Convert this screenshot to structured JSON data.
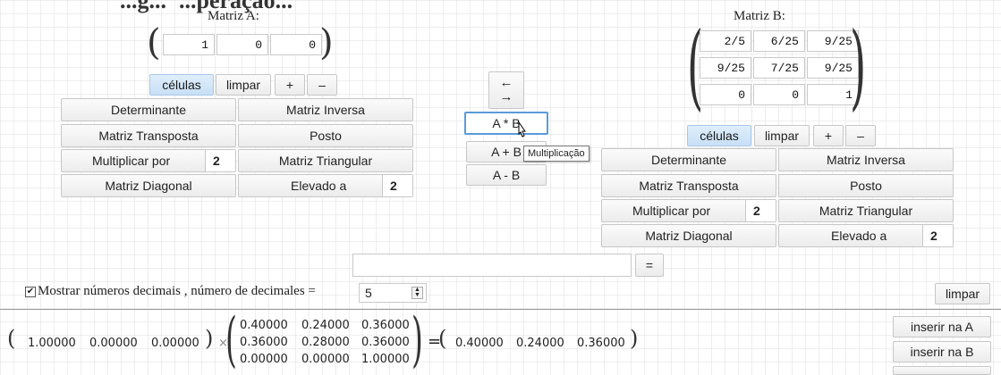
{
  "heading": {
    "text_a": "...g...",
    "text_b": "...peração..."
  },
  "matrixA": {
    "label": "Matriz A:",
    "cells": [
      "1",
      "0",
      "0"
    ],
    "toolbar": {
      "cells_label": "células",
      "clear_label": "limpar",
      "add_label": "+",
      "remove_label": "–"
    },
    "ops": {
      "determinant": "Determinante",
      "inverse": "Matriz Inversa",
      "transpose": "Matriz Transposta",
      "rank": "Posto",
      "multiply_by": "Multiplicar por",
      "multiply_value": "2",
      "triangular": "Matriz Triangular",
      "diagonal": "Matriz Diagonal",
      "power": "Elevado a",
      "power_value": "2"
    }
  },
  "matrixB": {
    "label": "Matriz B:",
    "cells": [
      [
        "2/5",
        "6/25",
        "9/25"
      ],
      [
        "9/25",
        "7/25",
        "9/25"
      ],
      [
        "0",
        "0",
        "1"
      ]
    ],
    "toolbar": {
      "cells_label": "células",
      "clear_label": "limpar",
      "add_label": "+",
      "remove_label": "–"
    },
    "ops": {
      "determinant": "Determinante",
      "inverse": "Matriz Inversa",
      "transpose": "Matriz Transposta",
      "rank": "Posto",
      "multiply_by": "Multiplicar por",
      "multiply_value": "2",
      "triangular": "Matriz Triangular",
      "diagonal": "Matriz Diagonal",
      "power": "Elevado a",
      "power_value": "2"
    }
  },
  "center": {
    "arrow_left": "←",
    "arrow_right": "→",
    "a_times_b": "A * B",
    "a_plus_b": "A + B",
    "a_minus_b": "A - B",
    "tooltip": "Multiplicação"
  },
  "expression": {
    "value": "",
    "equals_label": "="
  },
  "options": {
    "checked": true,
    "show_decimals_label": "Mostrar números decimais , número de decimales =",
    "decimals_value": "5",
    "clear_label": "limpar"
  },
  "result": {
    "left_row": [
      "1.00000",
      "0.00000",
      "0.00000"
    ],
    "matrix": [
      [
        "0.40000",
        "0.24000",
        "0.36000"
      ],
      [
        "0.36000",
        "0.28000",
        "0.36000"
      ],
      [
        "0.00000",
        "0.00000",
        "1.00000"
      ]
    ],
    "result_row": [
      "0.40000",
      "0.24000",
      "0.36000"
    ],
    "times_symbol": "×",
    "equals_symbol": "=",
    "insert_a_label": "inserir na A",
    "insert_b_label": "inserir na B"
  }
}
